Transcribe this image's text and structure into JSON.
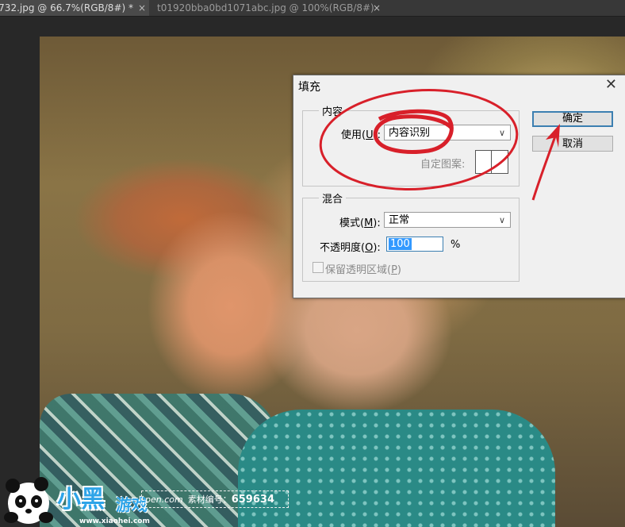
{
  "tabs": [
    {
      "label": "732.jpg @ 66.7%(RGB/8#) *",
      "active": true
    },
    {
      "label": "t01920bba0bd1071abc.jpg @ 100%(RGB/8#)",
      "active": false
    }
  ],
  "tab_close_glyph": "×",
  "dialog": {
    "title": "填充",
    "close_glyph": "✕",
    "content_group": {
      "legend": "内容",
      "use_label": "使用(",
      "use_key": "U",
      "use_label_end": "):",
      "use_value": "内容识别",
      "pattern_label": "自定图案:"
    },
    "blend_group": {
      "legend": "混合",
      "mode_label": "模式(",
      "mode_key": "M",
      "mode_label_end": "):",
      "mode_value": "正常",
      "opacity_label": "不透明度(",
      "opacity_key": "O",
      "opacity_label_end": "):",
      "opacity_value": "100",
      "opacity_unit": "%",
      "preserve_label": "保留透明区域(",
      "preserve_key": "P",
      "preserve_label_end": ")"
    },
    "ok_label": "确定",
    "cancel_label": "取消"
  },
  "watermark": {
    "logo_text": "小黑",
    "logo_text2": "游戏",
    "url": "www.xiaohei.com",
    "site_fragment": "pen.com",
    "stock_label": "素材编号：",
    "stock_number": "659634"
  },
  "colors": {
    "annotation_red": "#d8202a",
    "accent_blue": "#3c7fb1",
    "selection_blue": "#3399ff"
  }
}
